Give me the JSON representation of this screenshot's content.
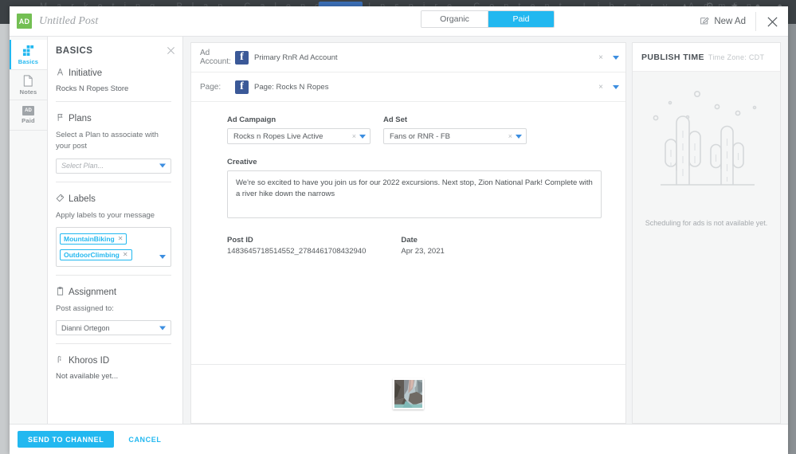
{
  "background": {
    "nav_text": "Marketing   Plan   Calendar   Inspire   Content   Library   Admin",
    "right_icons": "▲ ⚙ ★ ● ●"
  },
  "header": {
    "ad_badge": "AD",
    "post_title": "Untitled Post",
    "modes": [
      {
        "label": "Organic",
        "active": false
      },
      {
        "label": "Paid",
        "active": true
      }
    ],
    "new_ad_label": "New Ad",
    "new_ad_icon": "pencil-square-icon",
    "close_icon": "close-icon"
  },
  "tab_rail": [
    {
      "label": "Basics",
      "icon": "blocks-icon",
      "active": true
    },
    {
      "label": "Notes",
      "icon": "document-icon",
      "active": false
    },
    {
      "label": "Paid",
      "icon": "ad-chip-icon",
      "active": false,
      "chip": "AD"
    }
  ],
  "basics": {
    "title": "BASICS",
    "close_icon": "close-icon",
    "sections": {
      "initiative": {
        "title": "Initiative",
        "icon": "initiative-icon",
        "value": "Rocks N Ropes Store"
      },
      "plans": {
        "title": "Plans",
        "icon": "flag-icon",
        "description": "Select a Plan to associate with your post",
        "select_placeholder": "Select Plan...",
        "select_value": ""
      },
      "labels": {
        "title": "Labels",
        "icon": "tag-icon",
        "description": "Apply labels to your message",
        "chips": [
          "MountainBiking",
          "OutdoorClimbing"
        ]
      },
      "assignment": {
        "title": "Assignment",
        "icon": "clipboard-icon",
        "description": "Post assigned to:",
        "select_value": "Dianni Ortegon"
      },
      "khoros_id": {
        "title": "Khoros ID",
        "icon": "khoros-icon",
        "value": "Not available yet..."
      }
    }
  },
  "main": {
    "ad_account": {
      "label": "Ad Account:",
      "icon": "facebook-icon",
      "value": "Primary RnR Ad Account",
      "clear": "×"
    },
    "page": {
      "label": "Page:",
      "icon": "facebook-icon",
      "value": "Page: Rocks N Ropes",
      "clear": "×"
    },
    "ad_campaign": {
      "label": "Ad Campaign",
      "value": "Rocks n Ropes Live Active",
      "clear": "×"
    },
    "ad_set": {
      "label": "Ad Set",
      "value": "Fans or RNR - FB",
      "clear": "×"
    },
    "creative": {
      "label": "Creative",
      "value": "We're so excited to have you join us for our 2022 excursions. Next stop, Zion National Park! Complete with a river hike down the narrows"
    },
    "post_id": {
      "label": "Post ID",
      "value": "1483645718514552_2784461708432940"
    },
    "date": {
      "label": "Date",
      "value": "Apr 23, 2021"
    },
    "attachment": {
      "name": "canyon-river-thumbnail"
    }
  },
  "publish": {
    "title": "PUBLISH TIME",
    "timezone": "Time Zone: CDT",
    "illustration": "cactus-desert-illustration",
    "message": "Scheduling for ads is not available yet."
  },
  "footer": {
    "send_label": "SEND TO CHANNEL",
    "cancel_label": "CANCEL"
  },
  "colors": {
    "accent": "#22b8f0",
    "ad_badge_green": "#73bf53",
    "facebook_blue": "#3b5998",
    "caret_blue": "#3c8ee0"
  }
}
